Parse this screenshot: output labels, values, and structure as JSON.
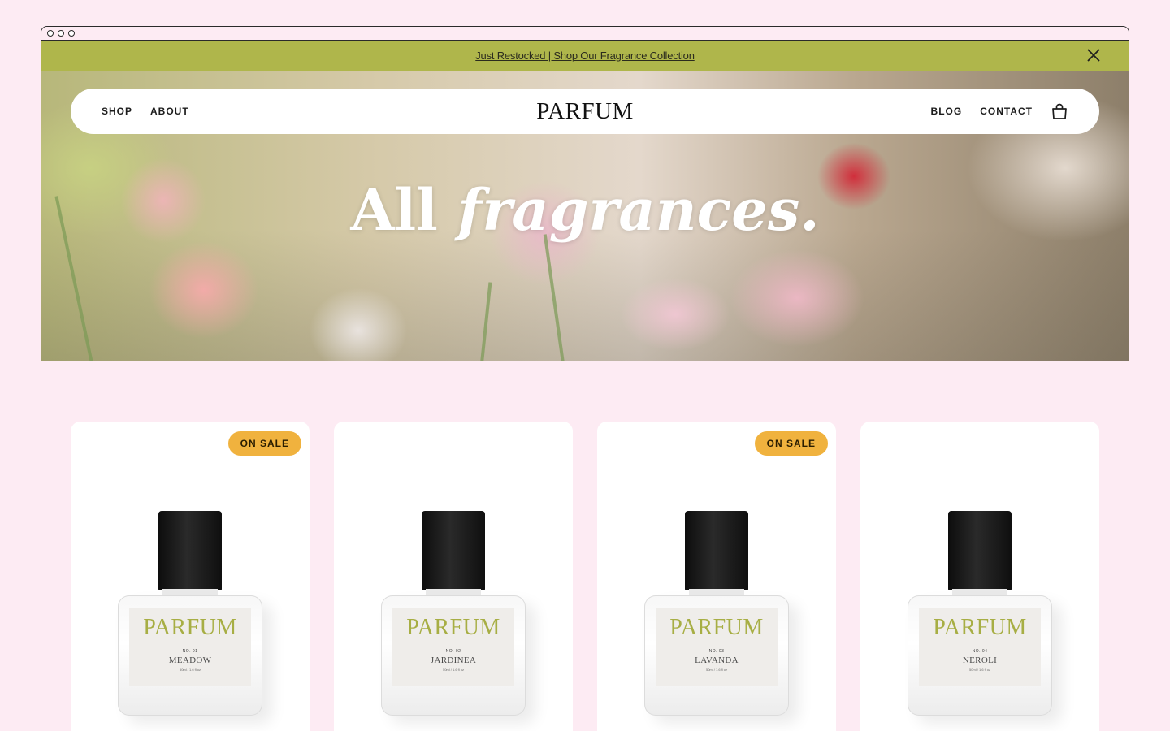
{
  "announcement": {
    "text": "Just Restocked | Shop Our Fragrance Collection",
    "close_icon": "close-icon"
  },
  "nav": {
    "left": [
      "SHOP",
      "ABOUT"
    ],
    "logo": "PARFUM",
    "right": [
      "BLOG",
      "CONTACT"
    ],
    "cart_icon": "shopping-bag-icon"
  },
  "hero": {
    "title_plain": "All",
    "title_italic": "fragrances."
  },
  "colors": {
    "page_bg": "#fdebf3",
    "announcement_bg": "#afb64b",
    "badge_bg": "#f0b23e",
    "label_accent": "#a7ae44"
  },
  "products": [
    {
      "badge": "ON SALE",
      "brand": "PARFUM",
      "number": "NO. 01",
      "name": "MEADOW",
      "volume": "50ml / 1.6 fl oz"
    },
    {
      "badge": "",
      "brand": "PARFUM",
      "number": "NO. 02",
      "name": "JARDINEA",
      "volume": "50ml / 1.6 fl oz"
    },
    {
      "badge": "ON SALE",
      "brand": "PARFUM",
      "number": "NO. 03",
      "name": "LAVANDA",
      "volume": "50ml / 1.6 fl oz"
    },
    {
      "badge": "",
      "brand": "PARFUM",
      "number": "NO. 04",
      "name": "NEROLI",
      "volume": "50ml / 1.6 fl oz"
    }
  ]
}
